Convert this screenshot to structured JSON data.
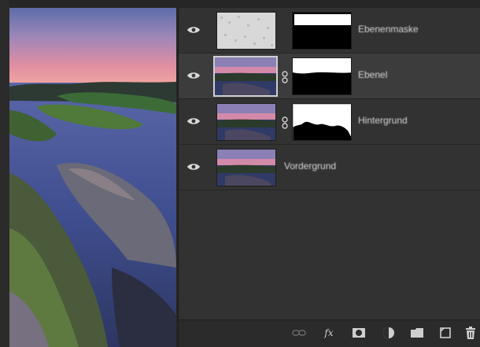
{
  "layers": [
    {
      "name": "Ebenenmaske",
      "visible": true,
      "selected": false,
      "thumb": "noise",
      "mask": "wide-top"
    },
    {
      "name": "Ebenel",
      "visible": true,
      "selected": true,
      "thumb": "landscape",
      "mask": "sky-only"
    },
    {
      "name": "Hintergrund",
      "visible": true,
      "selected": false,
      "thumb": "landscape",
      "mask": "rocks-silhouette"
    },
    {
      "name": "Vordergrund",
      "visible": true,
      "selected": false,
      "thumb": "landscape",
      "mask": null
    }
  ],
  "toolbar": {
    "buttons": [
      "link-layers-icon",
      "fx-icon",
      "add-mask-icon",
      "adjustment-layer-icon",
      "group-folder-icon",
      "new-layer-icon",
      "trash-icon"
    ],
    "fx_label": "fx"
  },
  "colors": {
    "panel_bg": "#323232",
    "selected_row": "#3c3c3c",
    "sky_top": "#5a6fa8",
    "sky_pink": "#e58aa0",
    "water": "#3c4f8c"
  }
}
